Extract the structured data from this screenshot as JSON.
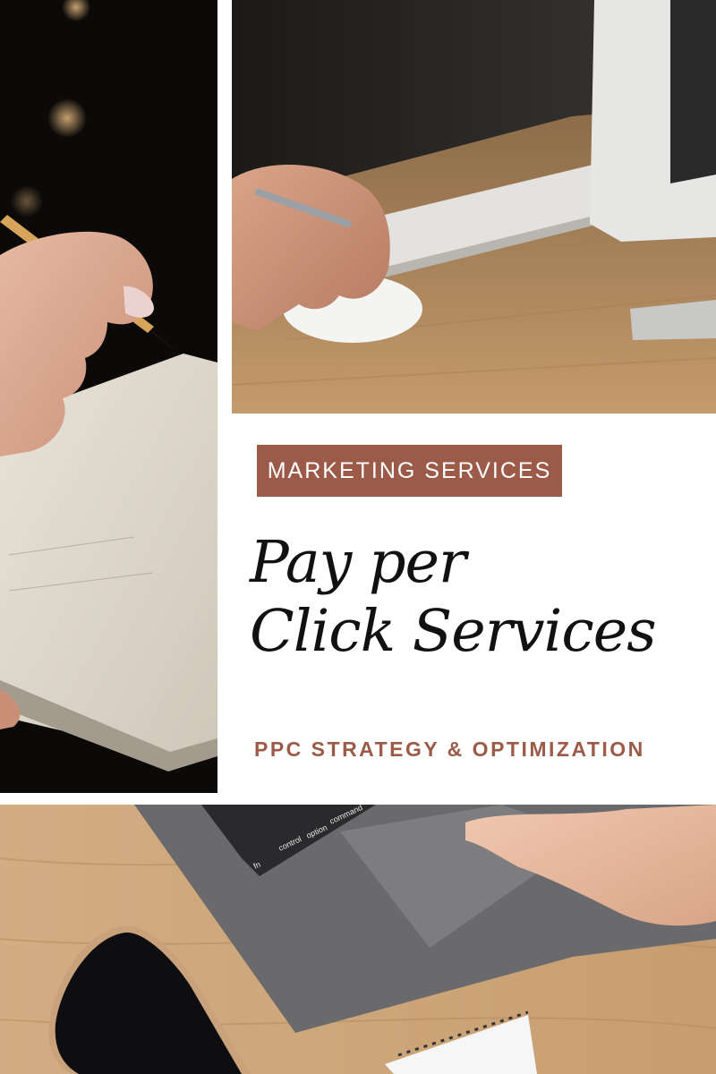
{
  "badge": {
    "label": "MARKETING SERVICES"
  },
  "title": {
    "line1": "Pay per",
    "line2": "Click Services"
  },
  "subtitle": {
    "label": "PPC STRATEGY & OPTIMIZATION"
  },
  "photos": {
    "writing": "hand-writing-in-notebook-photo",
    "mouse": "hand-on-computer-mouse-photo",
    "laptop": "hands-on-laptop-with-phone-photo"
  },
  "laptop_keys": {
    "control": "control",
    "option": "option",
    "command": "command",
    "fn": "fn"
  },
  "colors": {
    "accent": "#9c5a49",
    "title": "#111111",
    "wood": "#c9a57a"
  }
}
